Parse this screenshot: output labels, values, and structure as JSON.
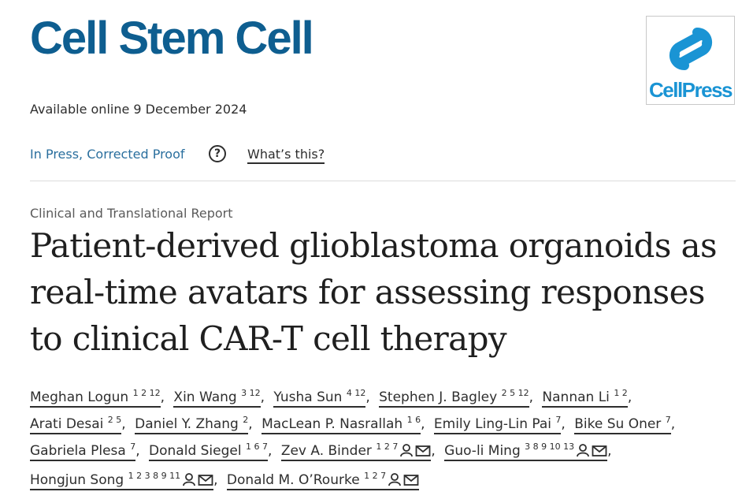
{
  "journal": {
    "name": "Cell Stem Cell",
    "publisher_logo_text": "CellPress",
    "publisher_brand_color": "#1a94d4",
    "title_color": "#0e5e90"
  },
  "availability": "Available online 9 December 2024",
  "status": {
    "label": "In Press, Corrected Proof",
    "help_icon": "question-circle-icon",
    "whats_this": "What’s this?"
  },
  "article": {
    "type": "Clinical and Translational Report",
    "title": "Patient-derived glioblastoma organoids as real-time avatars for assessing responses to clinical CAR-T cell therapy"
  },
  "authors": [
    {
      "name": "Meghan Logun",
      "affil": "1 2 12"
    },
    {
      "name": "Xin Wang",
      "affil": "3 12"
    },
    {
      "name": "Yusha Sun",
      "affil": "4 12"
    },
    {
      "name": "Stephen J. Bagley",
      "affil": "2 5 12"
    },
    {
      "name": "Nannan Li",
      "affil": "1 2"
    },
    {
      "name": "Arati Desai",
      "affil": "2 5"
    },
    {
      "name": "Daniel Y. Zhang",
      "affil": "2"
    },
    {
      "name": "MacLean P. Nasrallah",
      "affil": "1 6"
    },
    {
      "name": "Emily Ling-Lin Pai",
      "affil": "7"
    },
    {
      "name": "Bike Su Oner",
      "affil": "7"
    },
    {
      "name": "Gabriela Plesa",
      "affil": "7"
    },
    {
      "name": "Donald Siegel",
      "affil": "1 6 7"
    },
    {
      "name": "Zev A. Binder",
      "affil": "1 2 7",
      "icons": [
        "person-icon",
        "envelope-icon"
      ]
    },
    {
      "name": "Guo-li Ming",
      "affil": "3 8 9 10 13",
      "icons": [
        "person-icon",
        "envelope-icon"
      ]
    },
    {
      "name": "Hongjun Song",
      "affil": "1 2 3 8 9 11",
      "icons": [
        "person-icon",
        "envelope-icon"
      ]
    },
    {
      "name": "Donald M. O’Rourke",
      "affil": "1 2 7",
      "icons": [
        "person-icon",
        "envelope-icon"
      ]
    }
  ],
  "author_separator": ","
}
